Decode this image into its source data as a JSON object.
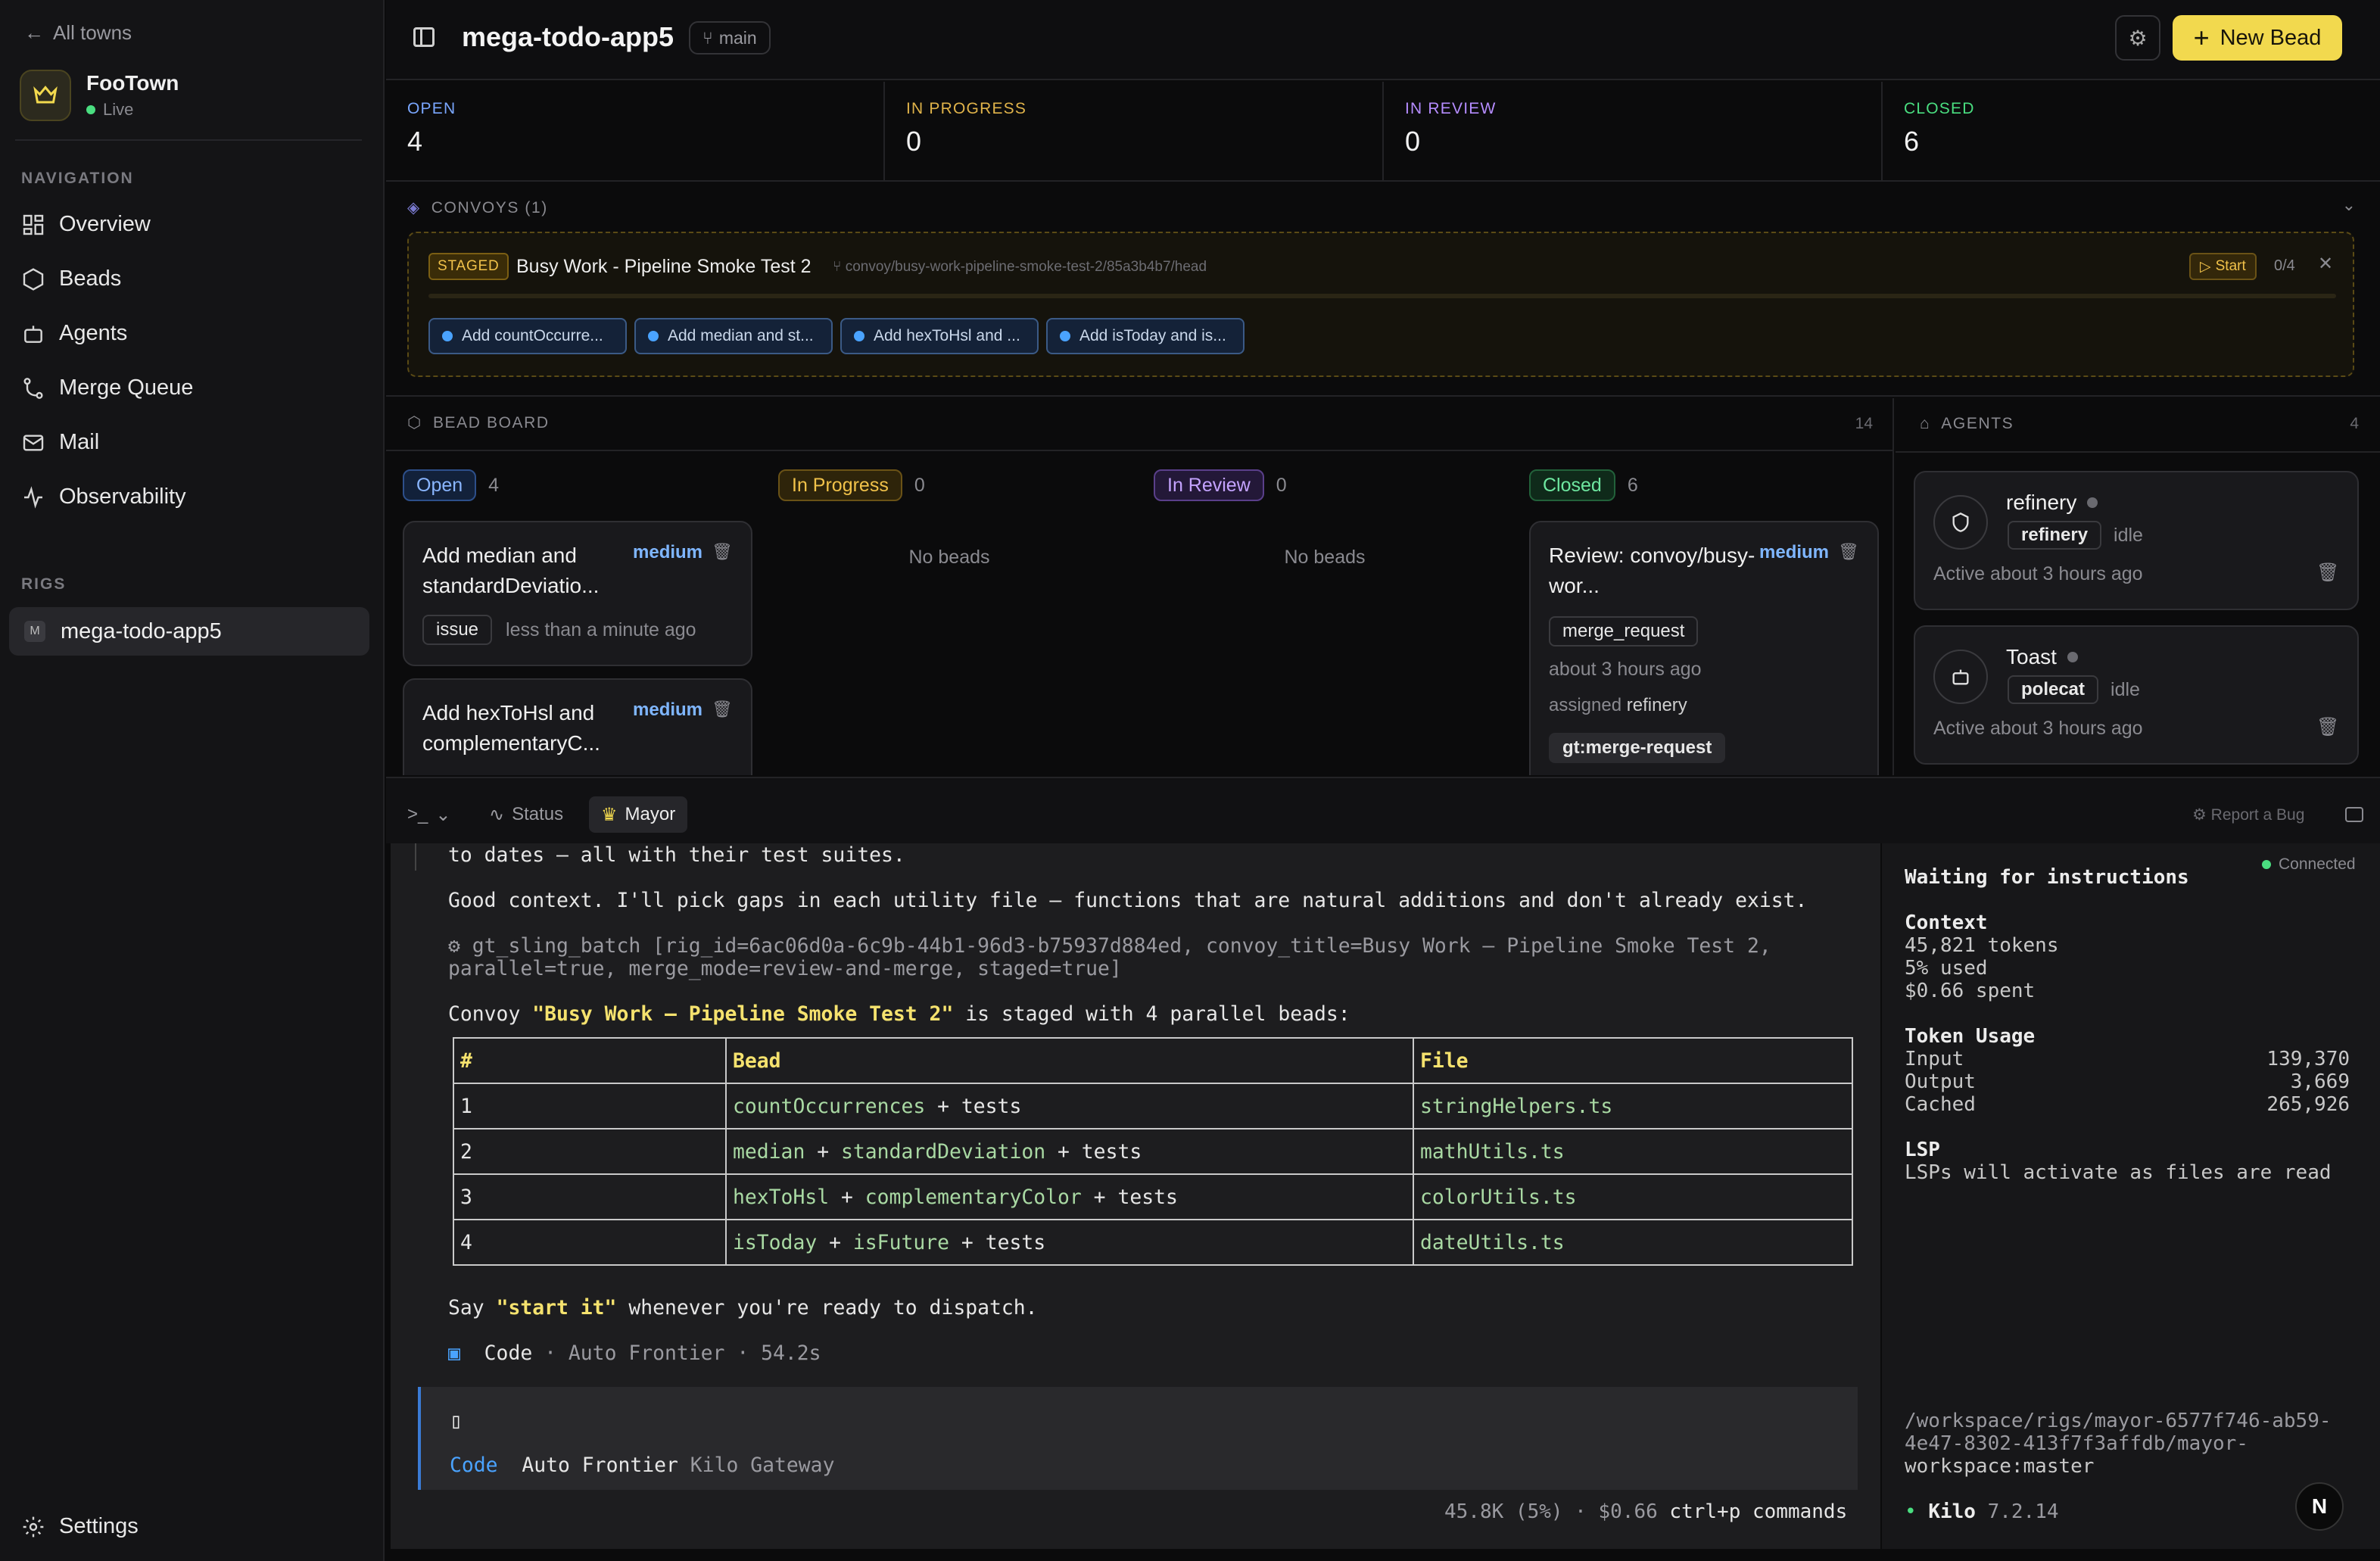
{
  "sidebar": {
    "back_label": "All towns",
    "town_name": "FooTown",
    "town_status": "Live",
    "nav_title": "NAVIGATION",
    "nav_items": [
      "Overview",
      "Beads",
      "Agents",
      "Merge Queue",
      "Mail",
      "Observability"
    ],
    "rigs_title": "RIGS",
    "rig_badge": "M",
    "rig_name": "mega-todo-app5",
    "settings_label": "Settings"
  },
  "header": {
    "title": "mega-todo-app5",
    "branch": "main",
    "new_bead_label": "New Bead"
  },
  "stats": [
    {
      "label": "OPEN",
      "value": "4",
      "color": "#7aa7ff"
    },
    {
      "label": "IN PROGRESS",
      "value": "0",
      "color": "#e0b34a"
    },
    {
      "label": "IN REVIEW",
      "value": "0",
      "color": "#b58cff"
    },
    {
      "label": "CLOSED",
      "value": "6",
      "color": "#4ade80"
    }
  ],
  "convoys": {
    "title": "CONVOYS (1)",
    "card": {
      "status": "STAGED",
      "name": "Busy Work - Pipeline Smoke Test 2",
      "path": "convoy/busy-work-pipeline-smoke-test-2/85a3b4b7/head",
      "start_label": "Start",
      "count": "0/4",
      "progress": 0,
      "chips": [
        "Add countOccurre...",
        "Add median and st...",
        "Add hexToHsl and ...",
        "Add isToday and is..."
      ]
    }
  },
  "board": {
    "title": "BEAD BOARD",
    "count": "14",
    "columns": [
      {
        "label": "Open",
        "count": "4"
      },
      {
        "label": "In Progress",
        "count": "0",
        "empty": "No beads"
      },
      {
        "label": "In Review",
        "count": "0",
        "empty": "No beads"
      },
      {
        "label": "Closed",
        "count": "6"
      }
    ],
    "open_cards": [
      {
        "title": "Add median and standardDeviatio...",
        "priority": "medium",
        "type": "issue",
        "time": "less than a minute ago"
      },
      {
        "title": "Add hexToHsl and complementaryC...",
        "priority": "medium"
      }
    ],
    "closed_cards": [
      {
        "title": "Review: convoy/busy-wor...",
        "priority": "medium",
        "type": "merge_request",
        "time": "about 3 hours ago",
        "assigned_prefix": "assigned",
        "assignee": "refinery",
        "label": "gt:merge-request"
      }
    ]
  },
  "agents": {
    "title": "AGENTS",
    "count": "4",
    "items": [
      {
        "name": "refinery",
        "role": "refinery",
        "state": "idle",
        "active": "Active about 3 hours ago",
        "icon": "shield-icon"
      },
      {
        "name": "Toast",
        "role": "polecat",
        "state": "idle",
        "active": "Active about 3 hours ago",
        "icon": "bot-icon"
      }
    ]
  },
  "terminal": {
    "tabs": [
      "Status",
      "Mayor"
    ],
    "report_label": "Report a Bug",
    "lines": {
      "l1": "to dates — all with their test suites.",
      "l2": "Good context. I'll pick gaps in each utility file — functions that are natural additions and don't already exist.",
      "l3a": "⚙ gt_sling_batch [rig_id=6ac06d0a-6c9b-44b1-96d3-b75937d884ed, convoy_title=Busy Work — Pipeline Smoke Test 2,",
      "l3b": "parallel=true, merge_mode=review-and-merge, staged=true]",
      "l4_pre": "Convoy ",
      "l4_hl": "\"Busy Work — Pipeline Smoke Test 2\"",
      "l4_post": " is staged with 4 parallel beads:",
      "l5_pre": "Say ",
      "l5_hl": "\"start it\"",
      "l5_post": " whenever you're ready to dispatch.",
      "l6_mark": "▣",
      "l6_mode": "Code",
      "l6_rest": " · Auto Frontier · 54.2s"
    },
    "table": {
      "headers": [
        "#",
        "Bead",
        "File"
      ],
      "rows": [
        {
          "n": "1",
          "a": "countOccurrences",
          "b": "",
          "c": "stringHelpers.ts"
        },
        {
          "n": "2",
          "a": "median",
          "b": "standardDeviation",
          "c": "mathUtils.ts"
        },
        {
          "n": "3",
          "a": "hexToHsl",
          "b": "complementaryColor",
          "c": "colorUtils.ts"
        },
        {
          "n": "4",
          "a": "isToday",
          "b": "isFuture",
          "c": "dateUtils.ts"
        }
      ],
      "plus": "+",
      "tests": "tests"
    },
    "input": {
      "cursor": "▯",
      "mode": "Code",
      "model": "Auto Frontier",
      "provider": "Kilo Gateway"
    },
    "status": "45.8K (5%) · $0.66",
    "shortcut": "ctrl+p commands"
  },
  "side": {
    "connected": "Connected",
    "waiting": "Waiting for instructions",
    "context_title": "Context",
    "tokens": "45,821 tokens",
    "used": "5% used",
    "spent": "$0.66 spent",
    "usage_title": "Token Usage",
    "input_label": "Input",
    "input_value": "139,370",
    "output_label": "Output",
    "output_value": "3,669",
    "cached_label": "Cached",
    "cached_value": "265,926",
    "lsp_title": "LSP",
    "lsp_text": "LSPs will activate as files are read",
    "path1": "/workspace/rigs/mayor-6577f746-ab59-",
    "path2": "4e47-8302-413f7f3affdb/mayor-",
    "path3": "workspace:master",
    "kilo_label": "Kilo",
    "kilo_version": "7.2.14"
  },
  "avatar_letter": "N"
}
